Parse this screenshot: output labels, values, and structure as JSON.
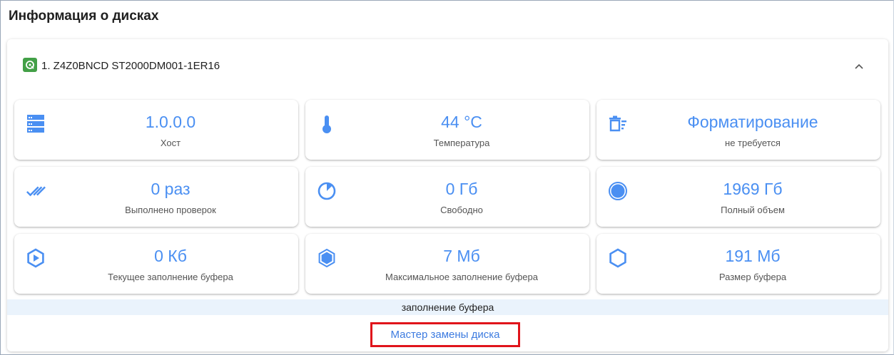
{
  "page": {
    "title": "Информация о дисках"
  },
  "disk": {
    "name": "1. Z4Z0BNCD ST2000DM001-1ER16",
    "icon": "hdd-status-icon",
    "expand_icon": "chevron-up-icon"
  },
  "stats": [
    {
      "id": "host",
      "value": "1.0.0.0",
      "label": "Хост",
      "icon": "server-icon"
    },
    {
      "id": "temperature",
      "value": "44 °C",
      "label": "Температура",
      "icon": "thermometer-icon"
    },
    {
      "id": "format",
      "value": "Форматирование",
      "label": "не требуется",
      "icon": "delete-sweep-icon"
    },
    {
      "id": "checks",
      "value": "0 раз",
      "label": "Выполнено проверок",
      "icon": "double-check-icon"
    },
    {
      "id": "free",
      "value": "0 Гб",
      "label": "Свободно",
      "icon": "pie-gauge-icon"
    },
    {
      "id": "total",
      "value": "1969 Гб",
      "label": "Полный объем",
      "icon": "filled-circle-icon"
    },
    {
      "id": "buffer_current",
      "value": "0 Кб",
      "label": "Текущее заполнение буфера",
      "icon": "hexagon-play-icon"
    },
    {
      "id": "buffer_max",
      "value": "7 Мб",
      "label": "Максимальное заполнение буфера",
      "icon": "hexagon-filled-icon"
    },
    {
      "id": "buffer_size",
      "value": "191 Мб",
      "label": "Размер буфера",
      "icon": "hexagon-outline-icon"
    }
  ],
  "buffer_bar": {
    "label": "заполнение буфера"
  },
  "actions": {
    "replace_wizard": "Мастер замены диска"
  },
  "colors": {
    "accent": "#4a8ff2",
    "highlight_border": "#e0141b",
    "disk_ok": "#43a047",
    "buffer_strip_bg": "#eaf3fc"
  }
}
